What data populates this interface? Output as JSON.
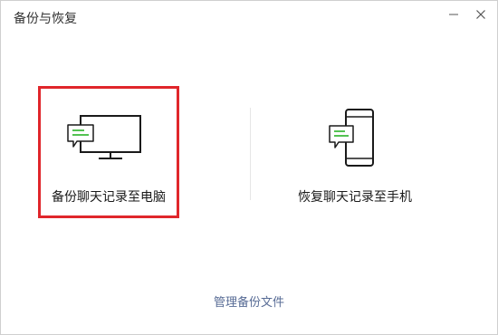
{
  "window": {
    "title": "备份与恢复",
    "minimize_icon": "minimize-icon",
    "close_icon": "close-icon"
  },
  "options": {
    "backup": {
      "label": "备份聊天记录至电脑",
      "icon": "computer-with-chat-icon",
      "selected": true
    },
    "restore": {
      "label": "恢复聊天记录至手机",
      "icon": "phone-with-chat-icon",
      "selected": false
    }
  },
  "footer": {
    "manage_link": "管理备份文件"
  },
  "colors": {
    "selection_border": "#e0262b",
    "chat_accent": "#1aad19",
    "link": "#576b95"
  }
}
